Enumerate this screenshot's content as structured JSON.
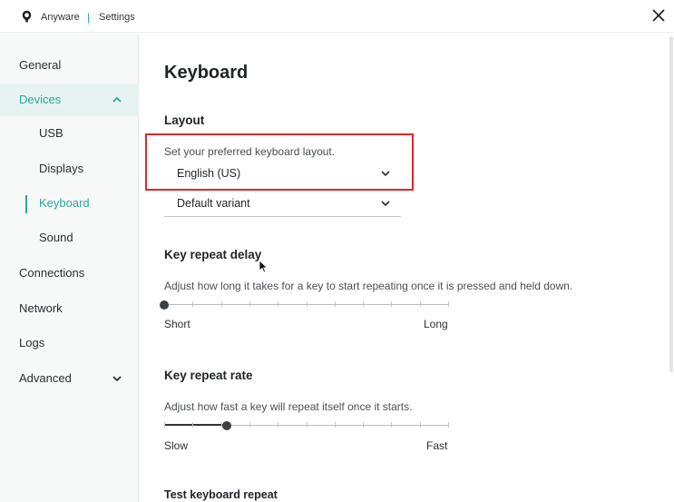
{
  "titlebar": {
    "app_name": "Anyware",
    "separator": "|",
    "section": "Settings"
  },
  "sidebar": {
    "items": [
      {
        "label": "General"
      },
      {
        "label": "Devices"
      },
      {
        "label": "USB"
      },
      {
        "label": "Displays"
      },
      {
        "label": "Keyboard"
      },
      {
        "label": "Sound"
      },
      {
        "label": "Connections"
      },
      {
        "label": "Network"
      },
      {
        "label": "Logs"
      },
      {
        "label": "Advanced"
      }
    ]
  },
  "main": {
    "title": "Keyboard",
    "layout": {
      "title": "Layout",
      "description": "Set your preferred keyboard layout.",
      "layout_value": "English (US)",
      "variant_value": "Default variant"
    },
    "repeat_delay": {
      "title": "Key repeat delay",
      "description": "Adjust how long it takes for a key to start repeating once it is pressed and held down.",
      "min_label": "Short",
      "max_label": "Long",
      "value": 0
    },
    "repeat_rate": {
      "title": "Key repeat rate",
      "description": "Adjust how fast a key will repeat itself once it starts.",
      "min_label": "Slow",
      "max_label": "Fast",
      "value": 0.22
    },
    "test": {
      "title": "Test keyboard repeat"
    }
  },
  "colors": {
    "accent": "#2aa89a",
    "highlight": "#e0262b"
  }
}
